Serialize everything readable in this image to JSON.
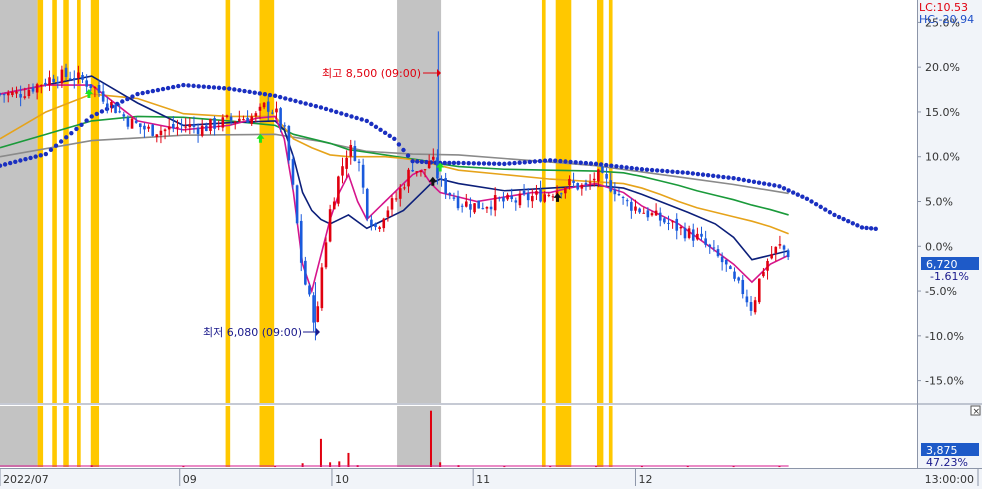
{
  "header": {
    "lc_label": "LC:10.53",
    "hc_label": "HC:-20.94",
    "lc_color": "#e0000f",
    "hc_color": "#2050c8"
  },
  "price_panel": {
    "current_value": "6,720",
    "current_change": "-1.61%",
    "tag_color": "#1e5ac8"
  },
  "volume_panel": {
    "current_value": "3,875",
    "current_ratio": "47.23%",
    "close_icon": "×"
  },
  "annotations": {
    "high": "최고 8,500 (09:00)",
    "low": "최저 6,080 (09:00)",
    "high_color": "#e0000f",
    "low_color": "#1a1a8c"
  },
  "colors": {
    "up": "#e0000f",
    "down": "#1a5adc",
    "highlight_yellow": "#ffc800",
    "highlight_grey": "#c3c3c3",
    "ma_short": "#d6158c",
    "ma_mid": "#0c1f7a",
    "ma_long": "#e6a31a",
    "ma_longer": "#1a9a3a",
    "ma_longest": "#8a8a8a",
    "envelope": "#1a2fc0"
  },
  "chart_data": {
    "type": "line",
    "title": "",
    "xlabel": "",
    "ylabel": "",
    "y_unit": "%",
    "ylim": [
      -17.5,
      27.5
    ],
    "y_ticks": [
      "25.0%",
      "20.0%",
      "15.0%",
      "10.0%",
      "5.0%",
      "0.0%",
      "-5.0%",
      "-10.0%",
      "-15.0%"
    ],
    "x_tick_labels": [
      "2022/07",
      "09",
      "10",
      "11",
      "12",
      "13:00:00"
    ],
    "x_range": [
      0,
      100
    ],
    "x_ticks": [
      0,
      19.6,
      36.2,
      51.6,
      69.3,
      100
    ],
    "highlight_bands": [
      {
        "kind": "grey",
        "from": 0.0,
        "to": 4.1
      },
      {
        "kind": "yellow",
        "from": 4.1,
        "to": 4.7
      },
      {
        "kind": "yellow",
        "from": 5.7,
        "to": 6.2
      },
      {
        "kind": "yellow",
        "from": 6.9,
        "to": 7.5
      },
      {
        "kind": "yellow",
        "from": 8.4,
        "to": 8.8
      },
      {
        "kind": "yellow",
        "from": 9.9,
        "to": 10.8
      },
      {
        "kind": "yellow",
        "from": 24.6,
        "to": 25.1
      },
      {
        "kind": "yellow",
        "from": 28.3,
        "to": 29.9
      },
      {
        "kind": "grey",
        "from": 43.3,
        "to": 48.1
      },
      {
        "kind": "yellow",
        "from": 59.1,
        "to": 59.5
      },
      {
        "kind": "yellow",
        "from": 60.6,
        "to": 62.3
      },
      {
        "kind": "yellow",
        "from": 65.1,
        "to": 65.8
      },
      {
        "kind": "yellow",
        "from": 66.4,
        "to": 66.8
      }
    ],
    "series": [
      {
        "role": "price",
        "x": [
          0,
          2,
          4,
          6,
          8,
          10,
          12,
          14,
          16,
          18,
          20,
          22,
          24,
          26,
          28,
          29,
          30,
          31,
          32,
          33,
          33.5,
          34,
          34.5,
          35,
          36,
          37,
          38,
          39,
          40,
          41,
          42,
          43,
          44,
          45,
          46,
          47,
          48,
          49,
          50,
          52,
          54,
          56,
          58,
          60,
          62,
          64,
          65,
          66,
          67,
          68,
          70,
          72,
          74,
          76,
          78,
          79,
          80,
          81,
          82,
          83,
          84,
          85,
          86
        ],
        "y": [
          17,
          17,
          18,
          19,
          19,
          18,
          16,
          14,
          13,
          13,
          13.5,
          13.2,
          13.8,
          14.3,
          14.5,
          15.8,
          15,
          13,
          6,
          -3,
          -5,
          -7,
          -9,
          -3,
          4,
          8,
          11,
          10,
          4,
          2,
          4,
          5,
          7,
          9,
          8,
          10,
          7,
          6,
          5,
          4.5,
          5,
          5,
          5.5,
          6,
          7,
          6.5,
          8,
          7.2,
          6.5,
          5,
          4,
          3,
          2,
          1,
          -1,
          -2,
          -4,
          -5,
          -7,
          -3,
          -1,
          0,
          -0.8
        ]
      },
      {
        "role": "ma_short",
        "x": [
          0,
          5,
          10,
          15,
          20,
          25,
          28,
          30,
          31,
          32,
          33,
          34,
          35,
          36,
          37,
          38,
          39,
          40,
          41,
          42,
          43,
          44,
          45,
          46,
          47,
          48,
          50,
          52,
          55,
          58,
          60,
          62,
          65,
          68,
          70,
          72,
          74,
          76,
          78,
          80,
          82,
          84,
          86
        ],
        "y": [
          17,
          18,
          18,
          14,
          13,
          13.5,
          14.3,
          14.5,
          12,
          6,
          -2,
          -5,
          -1,
          3,
          6,
          8,
          5,
          3,
          4,
          5,
          6,
          7,
          8,
          8.5,
          7,
          6,
          5.5,
          5,
          5.5,
          6,
          6,
          6.5,
          7,
          6,
          4.5,
          3.5,
          2.5,
          1,
          -0.5,
          -2,
          -4,
          -2,
          -1
        ]
      },
      {
        "role": "ma_mid",
        "x": [
          0,
          5,
          10,
          15,
          20,
          25,
          30,
          31,
          32,
          33,
          34,
          35,
          36,
          37,
          38,
          40,
          42,
          44,
          46,
          47,
          48,
          50,
          55,
          60,
          65,
          68,
          70,
          72,
          75,
          78,
          80,
          82,
          84,
          86
        ],
        "y": [
          17,
          18,
          19,
          16,
          13.5,
          13.8,
          14,
          13,
          10,
          6,
          4,
          3,
          2.5,
          3,
          3.5,
          2,
          3,
          4,
          6,
          7,
          7.5,
          7,
          6.2,
          6.5,
          6.8,
          6.5,
          5.8,
          5,
          3.8,
          2.5,
          1,
          -1.5,
          -1,
          -0.5
        ]
      },
      {
        "role": "ma_long",
        "x": [
          0,
          5,
          10,
          15,
          20,
          25,
          30,
          32,
          34,
          36,
          38,
          40,
          42,
          44,
          46,
          48,
          50,
          55,
          60,
          65,
          68,
          70,
          72,
          74,
          76,
          78,
          80,
          82,
          84,
          86
        ],
        "y": [
          12,
          15,
          17,
          16.5,
          14.8,
          14.5,
          14.5,
          12,
          11,
          10.2,
          10,
          10,
          10,
          9.8,
          9.5,
          9,
          8.5,
          8,
          7.5,
          7.2,
          7,
          6.5,
          5.8,
          5,
          4.3,
          3.8,
          3.3,
          2.8,
          2.2,
          1.4
        ]
      },
      {
        "role": "ma_longer",
        "x": [
          0,
          5,
          10,
          15,
          20,
          25,
          30,
          32,
          34,
          36,
          38,
          40,
          42,
          44,
          46,
          48,
          50,
          55,
          60,
          65,
          68,
          70,
          72,
          74,
          76,
          78,
          80,
          82,
          84,
          86
        ],
        "y": [
          11,
          12.5,
          14,
          14.5,
          14.4,
          14,
          13.5,
          12.5,
          12,
          11.5,
          10.8,
          10.5,
          10.2,
          9.9,
          9.6,
          9.2,
          8.9,
          8.6,
          8.5,
          8.4,
          8.2,
          7.8,
          7.3,
          6.8,
          6.2,
          5.7,
          5.2,
          4.6,
          4.1,
          3.5
        ]
      },
      {
        "role": "ma_longest",
        "x": [
          0,
          10,
          20,
          30,
          35,
          40,
          45,
          50,
          55,
          60,
          65,
          70,
          75,
          80,
          86
        ],
        "y": [
          10,
          11.8,
          12.4,
          12.5,
          11.7,
          10.6,
          10.3,
          10.2,
          9.8,
          9.4,
          9,
          8.3,
          7.6,
          6.9,
          5.9
        ]
      },
      {
        "role": "envelope",
        "x": [
          0,
          5,
          10,
          15,
          20,
          25,
          30,
          35,
          40,
          43,
          45,
          48,
          50,
          55,
          60,
          65,
          70,
          75,
          80,
          85,
          88,
          91,
          94,
          96
        ],
        "y": [
          9,
          10.3,
          14.5,
          17,
          18,
          17.6,
          16.8,
          15.5,
          14,
          12,
          9.5,
          9.3,
          9.3,
          9.2,
          9.6,
          9.2,
          8.6,
          8.2,
          7.6,
          6.7,
          5.3,
          3.5,
          2.1,
          1.9
        ]
      }
    ],
    "volume": {
      "x": [
        10,
        20,
        30,
        33,
        35,
        36,
        37,
        38,
        39,
        47,
        48,
        50,
        55,
        60,
        65,
        70,
        75,
        80,
        85
      ],
      "values": [
        2,
        1,
        1,
        4,
        30,
        5,
        6,
        15,
        2,
        60,
        5,
        2,
        1,
        1,
        1,
        1,
        1,
        1,
        1
      ],
      "ylim": [
        0,
        65
      ]
    }
  }
}
